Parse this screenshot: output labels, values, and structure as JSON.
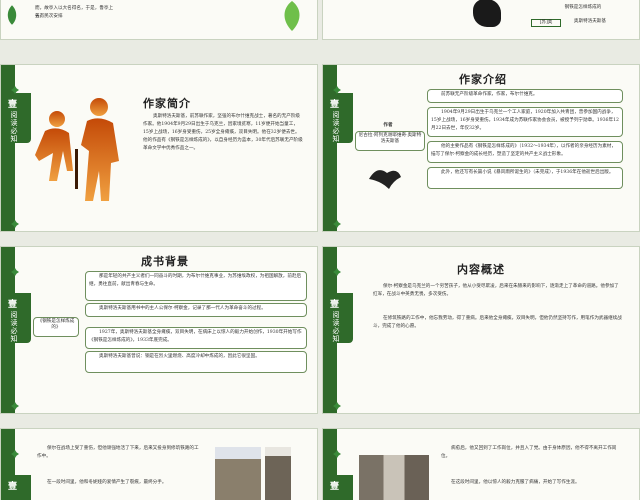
{
  "colors": {
    "accent_green": "#2f6a2a",
    "leaf_green": "#3a8a3a",
    "border": "#c9d3c0",
    "silhouette_orange": "#e06a10"
  },
  "tab": {
    "number": "壹",
    "sub": "阅读必知"
  },
  "top_left": {
    "text_a": "而，故亭入以大名得名，于是，鲁亭上名。",
    "text_b": "天有民次安排"
  },
  "top_right": {
    "caption": "钢铁是怎样炼成的",
    "tag_a": "[苏]奥",
    "tag_b": "奥斯特洛夫斯基"
  },
  "slide1": {
    "title": "作家简介",
    "body": "奥斯特洛夫斯基，前苏联作家，坚强的布尔什维克战士，著名的无产阶级作家。他1904年9月29日出生于乌克兰，因家境贫寒，11岁便开始当童工，15岁上战场，16岁身受重伤，25岁全身瘫痪，双目失明。他在32岁便去世。 他的作品有《钢铁是怎样炼成的》，以自身经历为蓝本，30年代后苏联无产阶级革命文学中优秀作品之一。"
  },
  "slide2": {
    "title": "作家介绍",
    "label_title": "作者",
    "label_sub": "尼古拉·阿列克谢耶维奇·奥斯特洛夫斯基",
    "p1": "前苏联无产阶级革命作家，作家，布尔什维克。",
    "p2": "1904年9月29日出生于乌克兰一个工人家庭，1920年加入共青团，曾参加国内战争，15岁上战场，16岁身受重伤。1934年成为苏联作家协会会员，被授予列宁勋章。1936年12月22日去世，年仅32岁。",
    "p3": "他的主要作品有《钢铁是怎样炼成的》（1932～1934年），以作者的亲身经历为素材，描写了保尔·柯察金的成长经历，塑造了坚定的共产主义战士形象。",
    "p4": "此外，他还写有长篇小说《暴风雨所诞生的》（未完成），于1936年在他逝世后出版。"
  },
  "slide3": {
    "title": "成书背景",
    "book_label": "《钢铁是怎样炼成的》",
    "p1": "那是年轻的共产主义者们一同奋斗的时期，为布尔什维克事业，为苏维埃政权，为祖国解放，前赴后继，勇往直前，献出青春与生命。",
    "p2": "奥斯特洛夫斯基用书中的主人公保尔·柯察金，记录了那一代人为革命奋斗的过程。",
    "p3": "1927年，奥斯特洛夫斯基全身瘫痪，双目失明，在病床上以惊人的毅力开始创作，1930年开始写作《钢铁是怎样炼成的》，1933年底完成。",
    "p4": "奥斯特洛夫斯基曾说：钢是在烈火里燃烧、高度冷却中炼成的，因此它很坚固。"
  },
  "slide4": {
    "title": "内容概述",
    "p1": "保尔·柯察金是乌克兰的一个穷苦孩子，他从小受尽欺凌，后来在朱赫来的影响下，逐渐走上了革命的道路。他参加了红军，在战斗中英勇无畏，多次受伤。",
    "p2": "在修筑铁路的工作中，他忘我劳动，得了重病。后来他全身瘫痪，双目失明，但他仍然坚持写作，用笔作为武器继续战斗，完成了他的心愿。"
  },
  "slide5": {
    "p1": "保尔在战场上受了重伤，但他顽强地活了下来，后来又投身到修筑铁路的工作中。",
    "p2": "在一段时间里，他和冬妮娅的爱情产生了裂痕，最终分手。"
  },
  "slide6": {
    "p1": "病愈后，他又回到了工作岗位，并且入了党。由于身体原因，他不得不离开工作岗位。",
    "p2": "在这段时间里，他以惊人的毅力克服了病痛，开始了写作生涯。"
  }
}
